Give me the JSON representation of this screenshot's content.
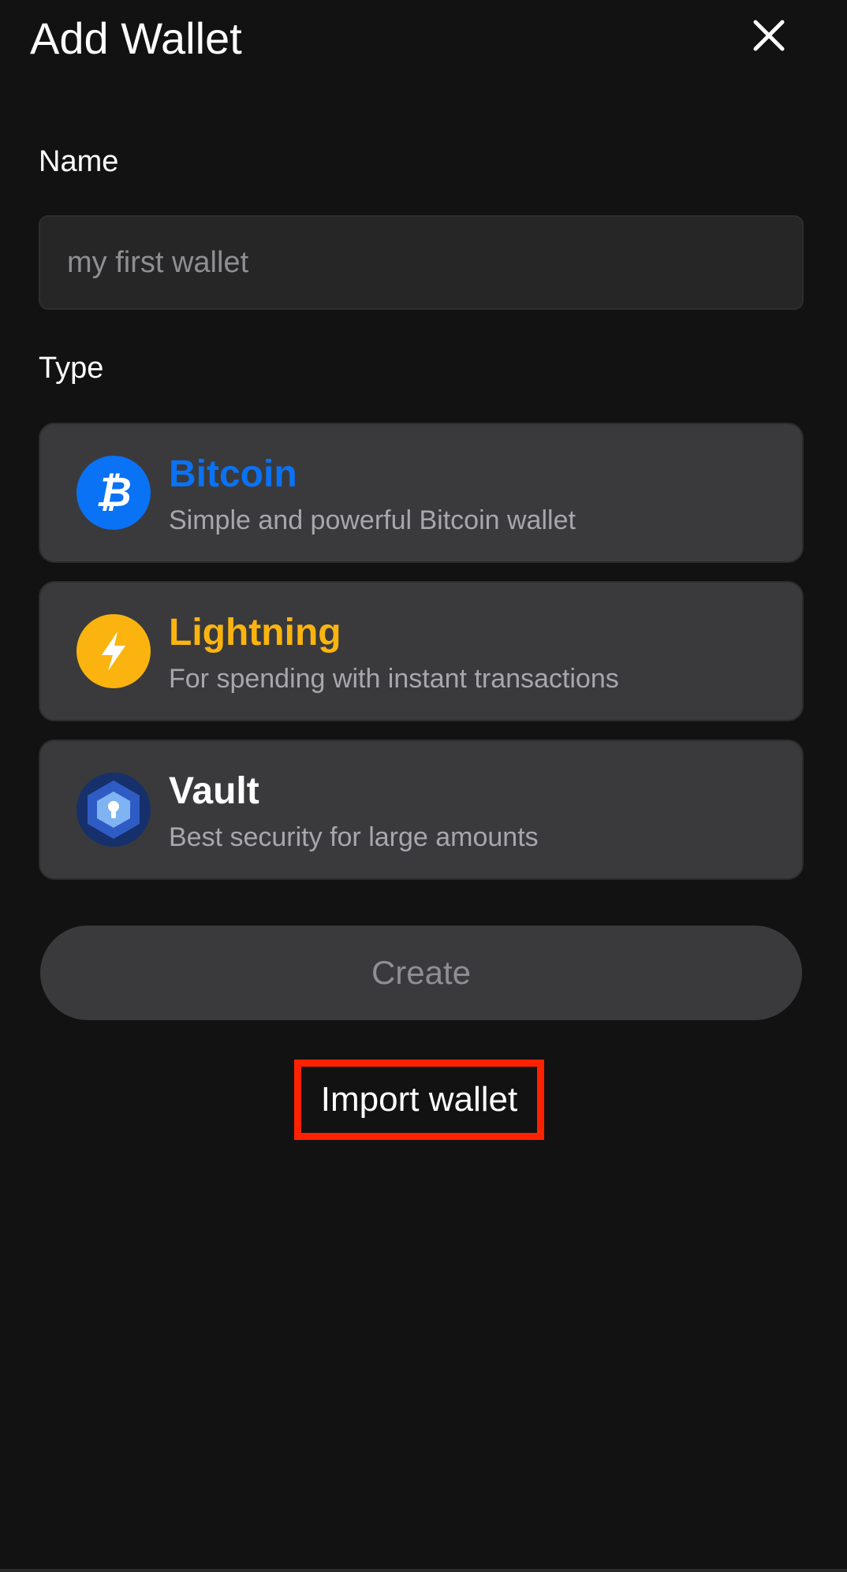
{
  "header": {
    "title": "Add Wallet",
    "close_icon": "close-icon"
  },
  "name_field": {
    "label": "Name",
    "value": "",
    "placeholder": "my first wallet"
  },
  "type_field": {
    "label": "Type",
    "options": [
      {
        "title": "Bitcoin",
        "description": "Simple and powerful Bitcoin wallet",
        "icon": "bitcoin-icon",
        "color": "#0a72f5"
      },
      {
        "title": "Lightning",
        "description": "For spending with instant transactions",
        "icon": "lightning-icon",
        "color": "#fbb40f"
      },
      {
        "title": "Vault",
        "description": "Best security for large amounts",
        "icon": "vault-icon",
        "color": "#ffffff"
      }
    ]
  },
  "actions": {
    "create_label": "Create",
    "import_label": "Import wallet"
  },
  "colors": {
    "background": "#121212",
    "card": "#3a3a3c",
    "input": "#262626",
    "highlight_box": "#ff2200"
  }
}
